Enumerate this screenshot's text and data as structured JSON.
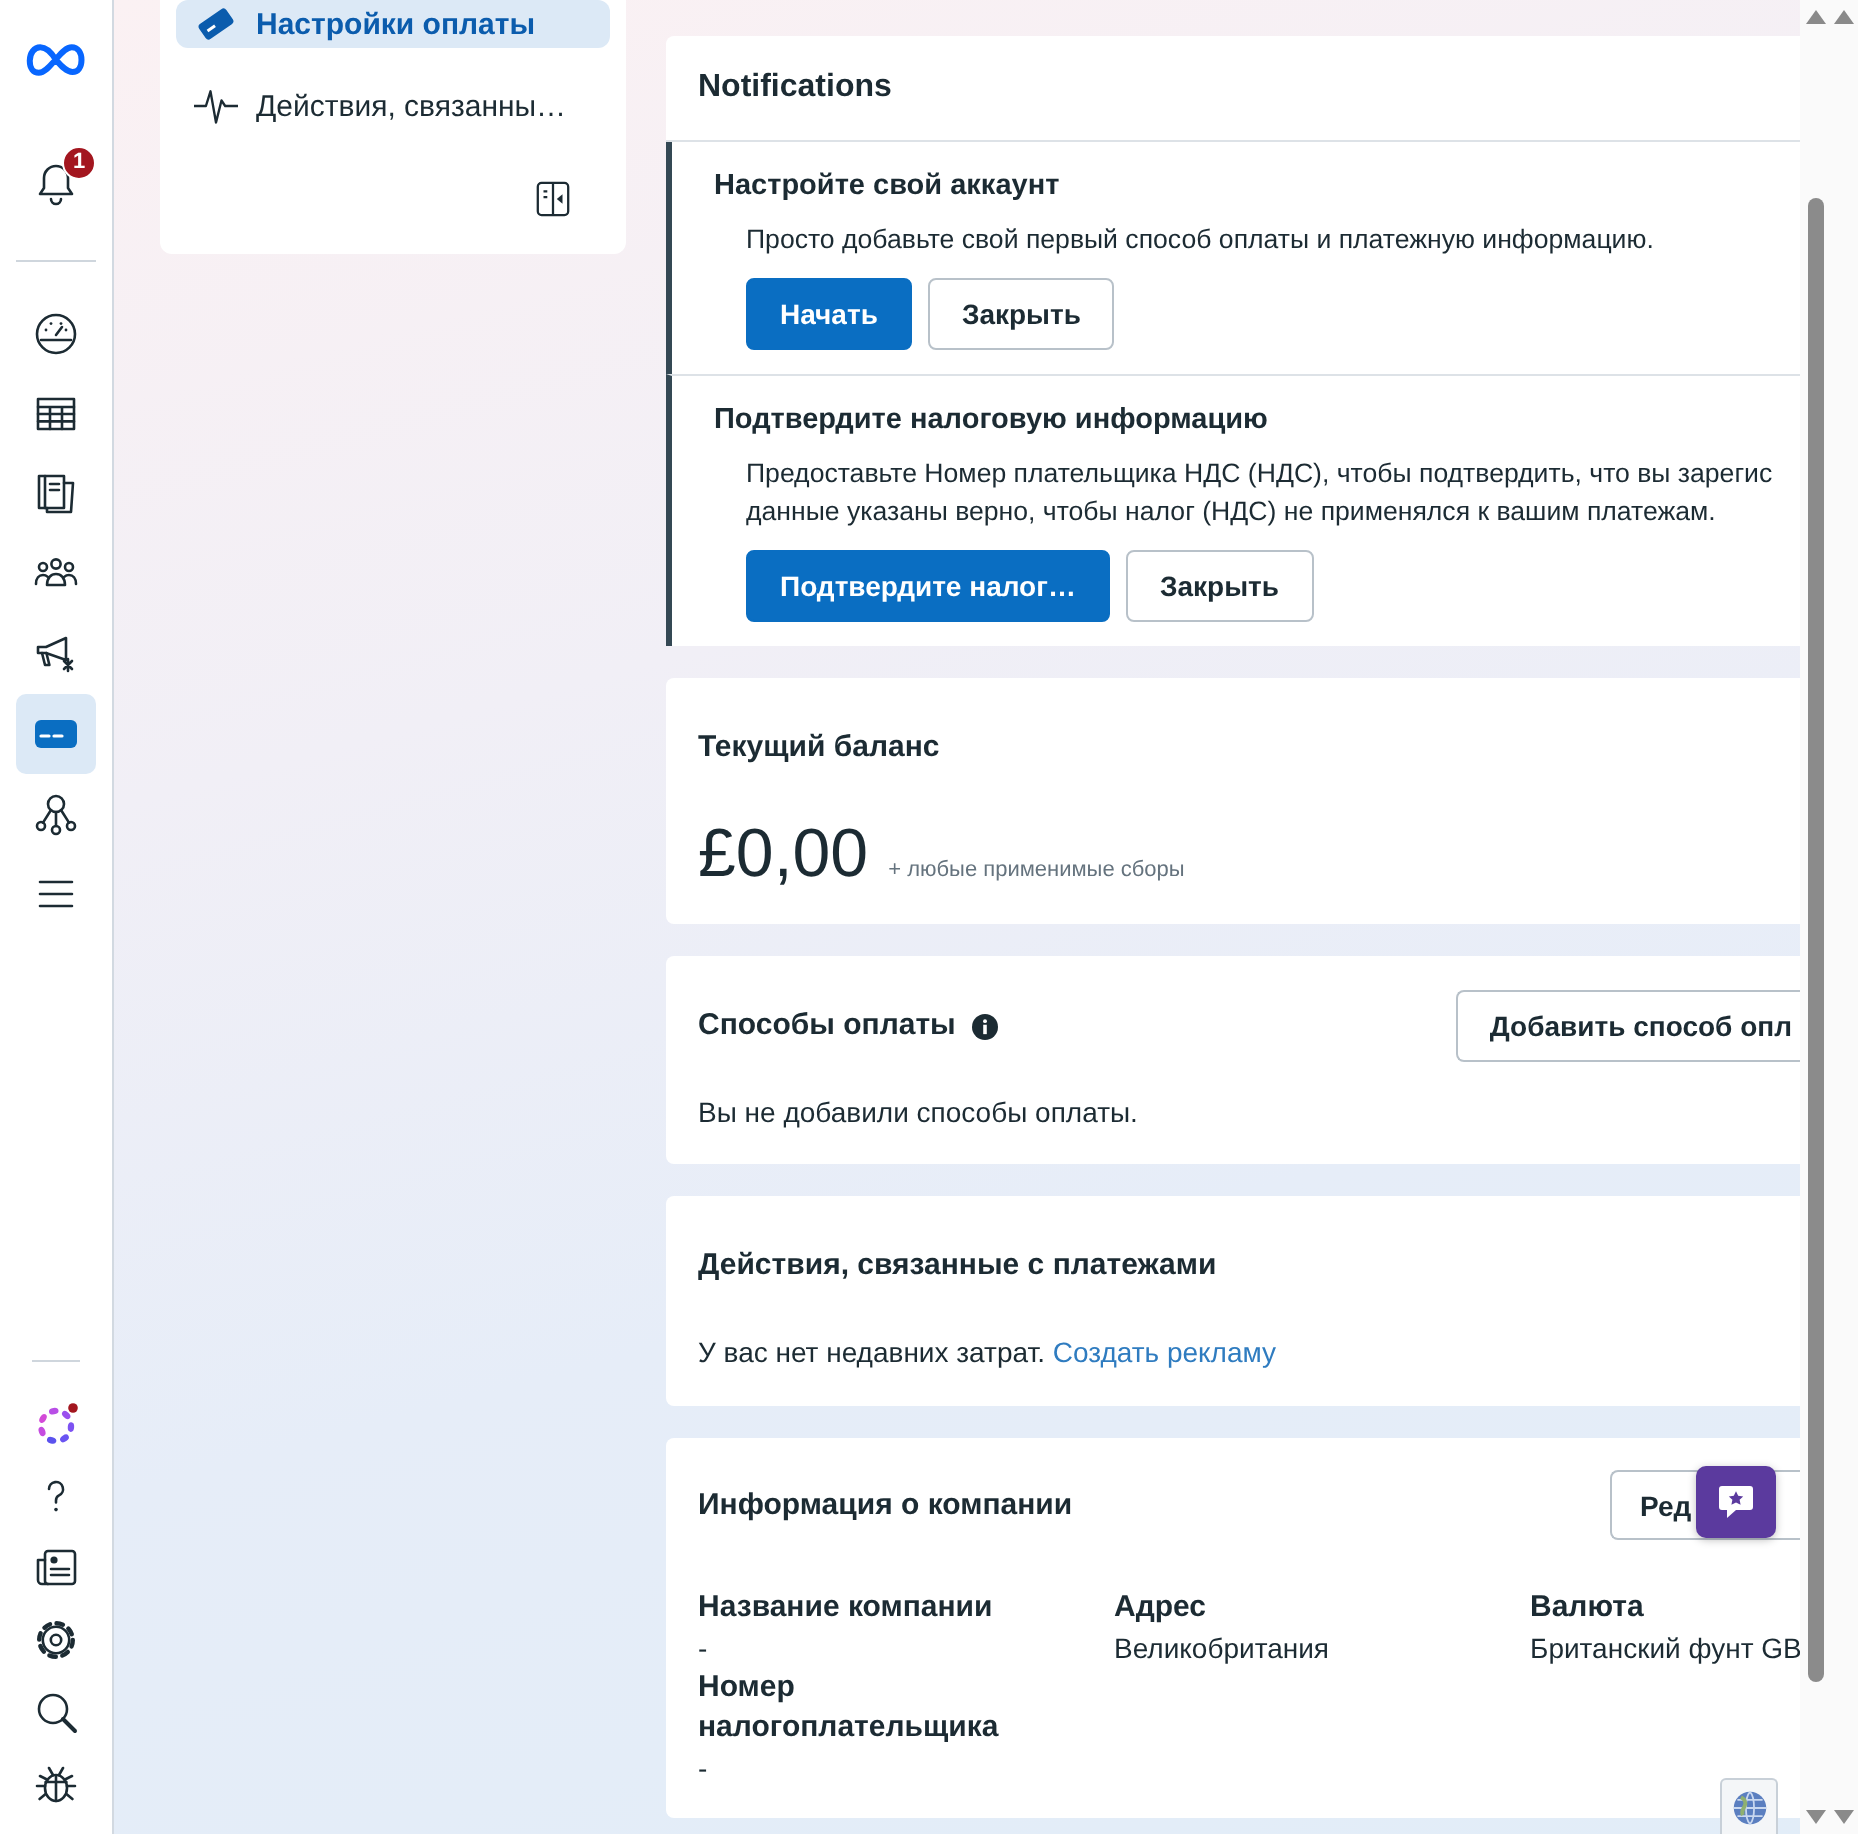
{
  "nav_rail": {
    "bell_badge": "1",
    "items": [
      {
        "selected": false
      },
      {
        "selected": false
      },
      {
        "selected": false
      },
      {
        "selected": false
      },
      {
        "selected": false
      },
      {
        "selected": true
      },
      {
        "selected": false
      },
      {
        "selected": false
      }
    ],
    "bottom_items": [
      {
        "selected": false
      },
      {
        "selected": false
      },
      {
        "selected": false
      },
      {
        "selected": false
      },
      {
        "selected": false
      },
      {
        "selected": false
      }
    ]
  },
  "sidebar": {
    "items": [
      {
        "label": "Настройки оплаты",
        "selected": true
      },
      {
        "label": "Действия, связанны…",
        "selected": false
      }
    ]
  },
  "notifications": {
    "title": "Notifications",
    "items": [
      {
        "title": "Настройте свой аккаунт",
        "text": [
          "Просто добавьте свой первый способ оплаты и платежную информацию."
        ],
        "buttons": [
          {
            "label": "Начать",
            "kind": "primary"
          },
          {
            "label": "Закрыть",
            "kind": "secondary"
          }
        ]
      },
      {
        "title": "Подтвердите налоговую информацию",
        "text": [
          "Предоставьте Номер плательщика НДС (НДС), чтобы подтвердить, что вы зарегис",
          "данные указаны верно, чтобы налог (НДС) не применялся к вашим платежам."
        ],
        "buttons": [
          {
            "label": "Подтвердите налог…",
            "kind": "primary"
          },
          {
            "label": "Закрыть",
            "kind": "secondary"
          }
        ]
      }
    ]
  },
  "balance": {
    "title": "Текущий баланс",
    "amount": "£0,00",
    "note": "+ любые применимые сборы"
  },
  "payment_methods": {
    "title": "Способы оплаты",
    "button": "Добавить способ опл",
    "empty_text": "Вы не добавили способы оплаты."
  },
  "payment_activity": {
    "title": "Действия, связанные с платежами",
    "text": "У вас нет недавних затрат.",
    "link": "Создать рекламу"
  },
  "company_info": {
    "title": "Информация о компании",
    "button": "Ред",
    "fields": [
      {
        "label": "Название компании",
        "value": "-"
      },
      {
        "label": "Адрес",
        "value": "Великобритания"
      },
      {
        "label": "Валюта",
        "value": "Британский фунт GB"
      },
      {
        "label": "Номер налогоплательщика",
        "value": "-"
      }
    ]
  }
}
